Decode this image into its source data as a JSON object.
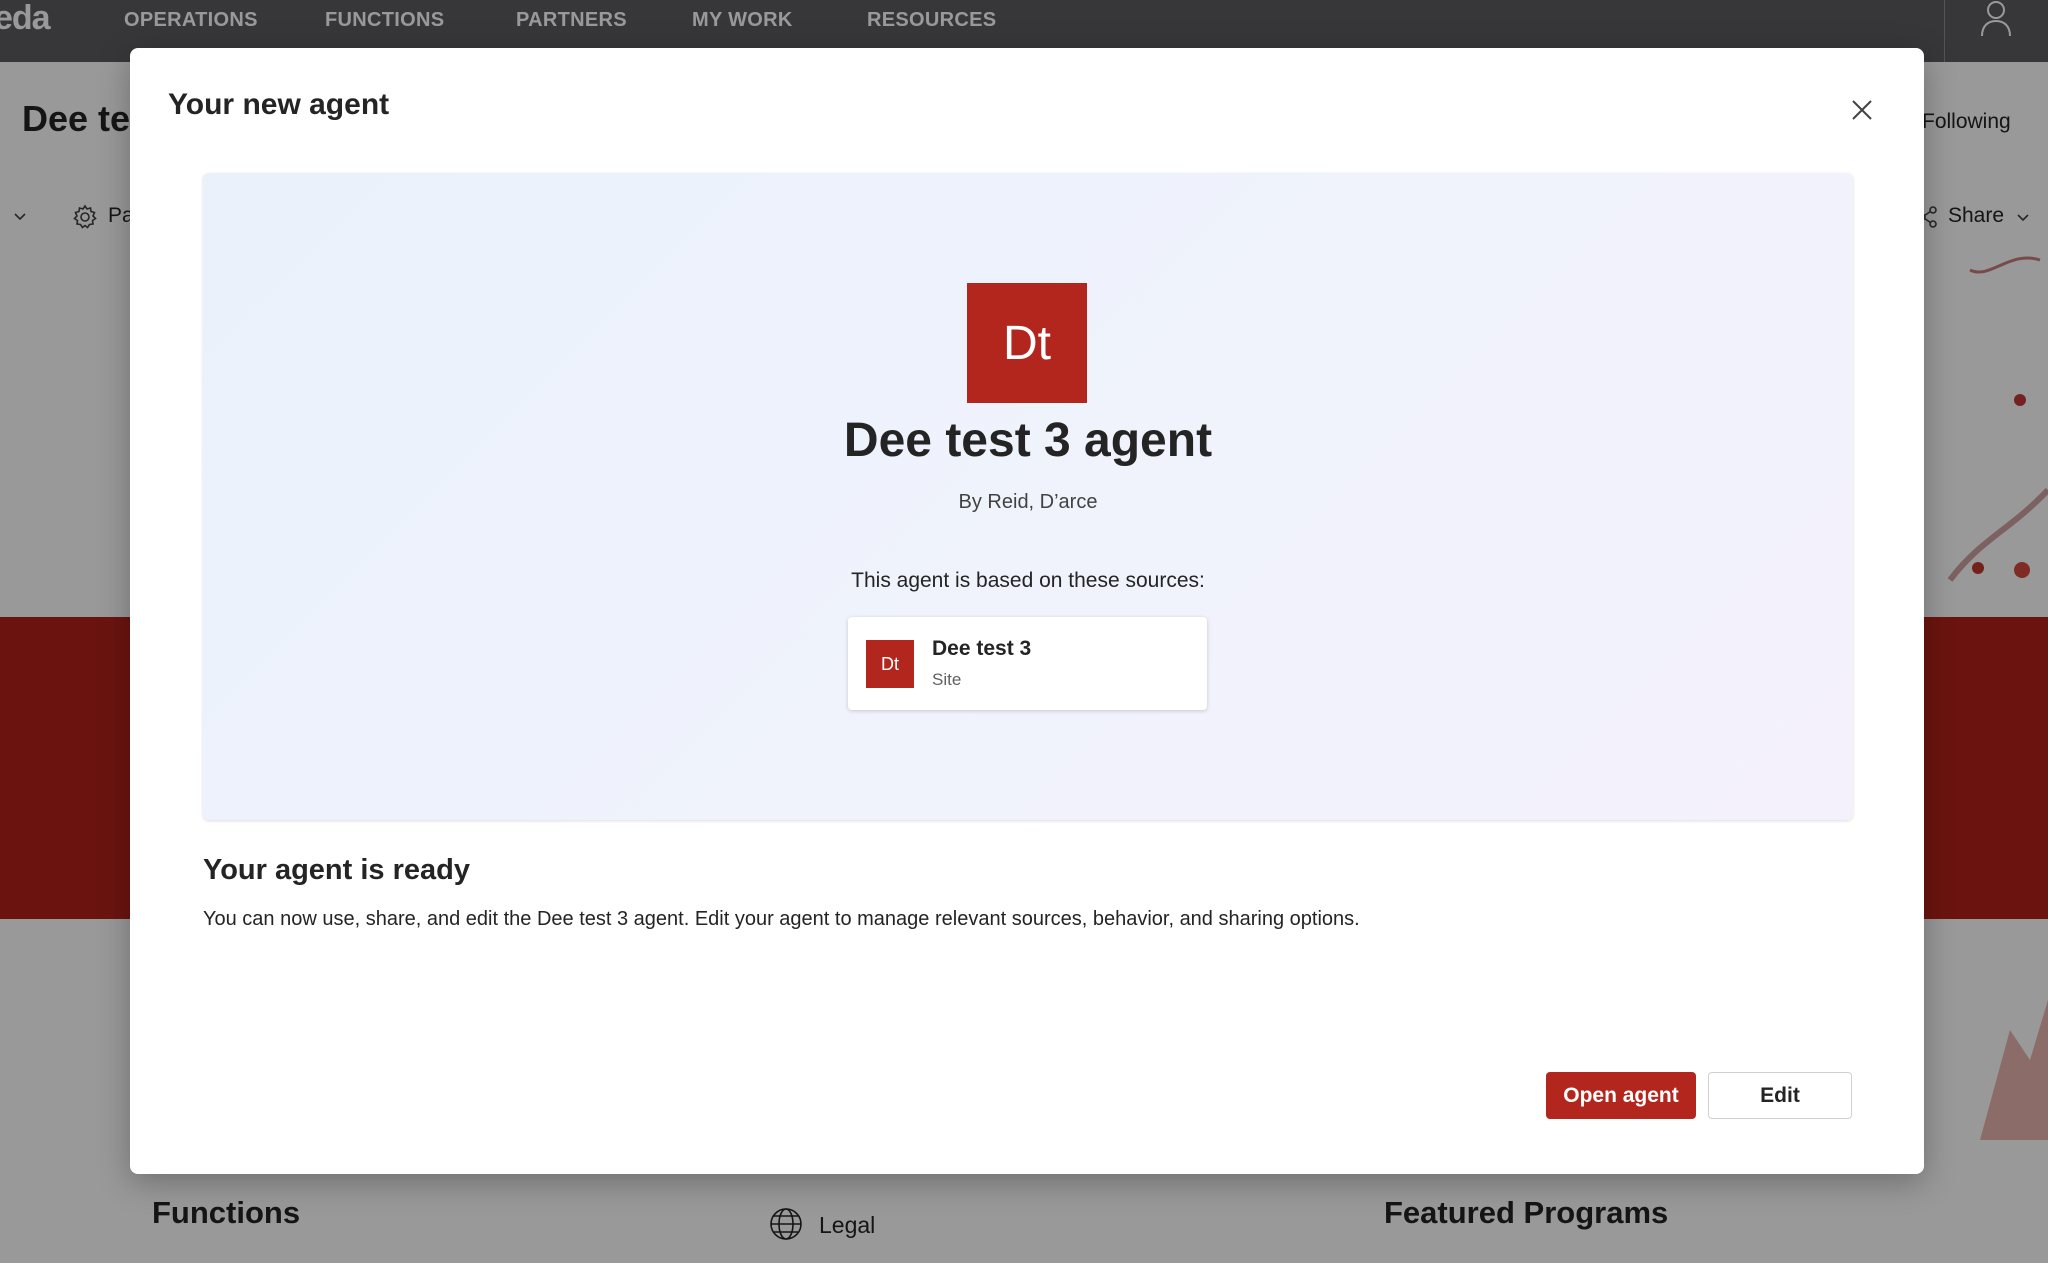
{
  "background": {
    "brand": "eda",
    "nav": [
      "OPERATIONS",
      "FUNCTIONS",
      "PARTNERS",
      "MY WORK",
      "RESOURCES"
    ],
    "site_title": "Dee te",
    "follow_label": "Following",
    "page_link": "Pa",
    "share_label": "Share",
    "sections": {
      "functions": "Functions",
      "legal": "Legal",
      "featured": "Featured Programs"
    },
    "icons": [
      "user-icon",
      "gear-icon",
      "share-icon",
      "chevron-down-icon",
      "globe-icon"
    ],
    "colors": {
      "nav_bg": "#5c5c61",
      "hero": "#b22219"
    }
  },
  "dialog": {
    "title": "Your new agent",
    "close_icon": "close-icon",
    "agent": {
      "initials": "Dt",
      "name": "Dee test 3 agent",
      "author": "By Reid, D’arce",
      "sources_label": "This agent is based on these sources:",
      "source": {
        "initials": "Dt",
        "name": "Dee test 3",
        "type": "Site"
      }
    },
    "ready_heading": "Your agent is ready",
    "ready_desc": "You can now use, share, and edit the Dee test 3 agent. Edit your agent to manage relevant sources, behavior, and sharing options.",
    "primary_button": "Open agent",
    "secondary_button": "Edit",
    "colors": {
      "accent": "#b3261e"
    }
  }
}
